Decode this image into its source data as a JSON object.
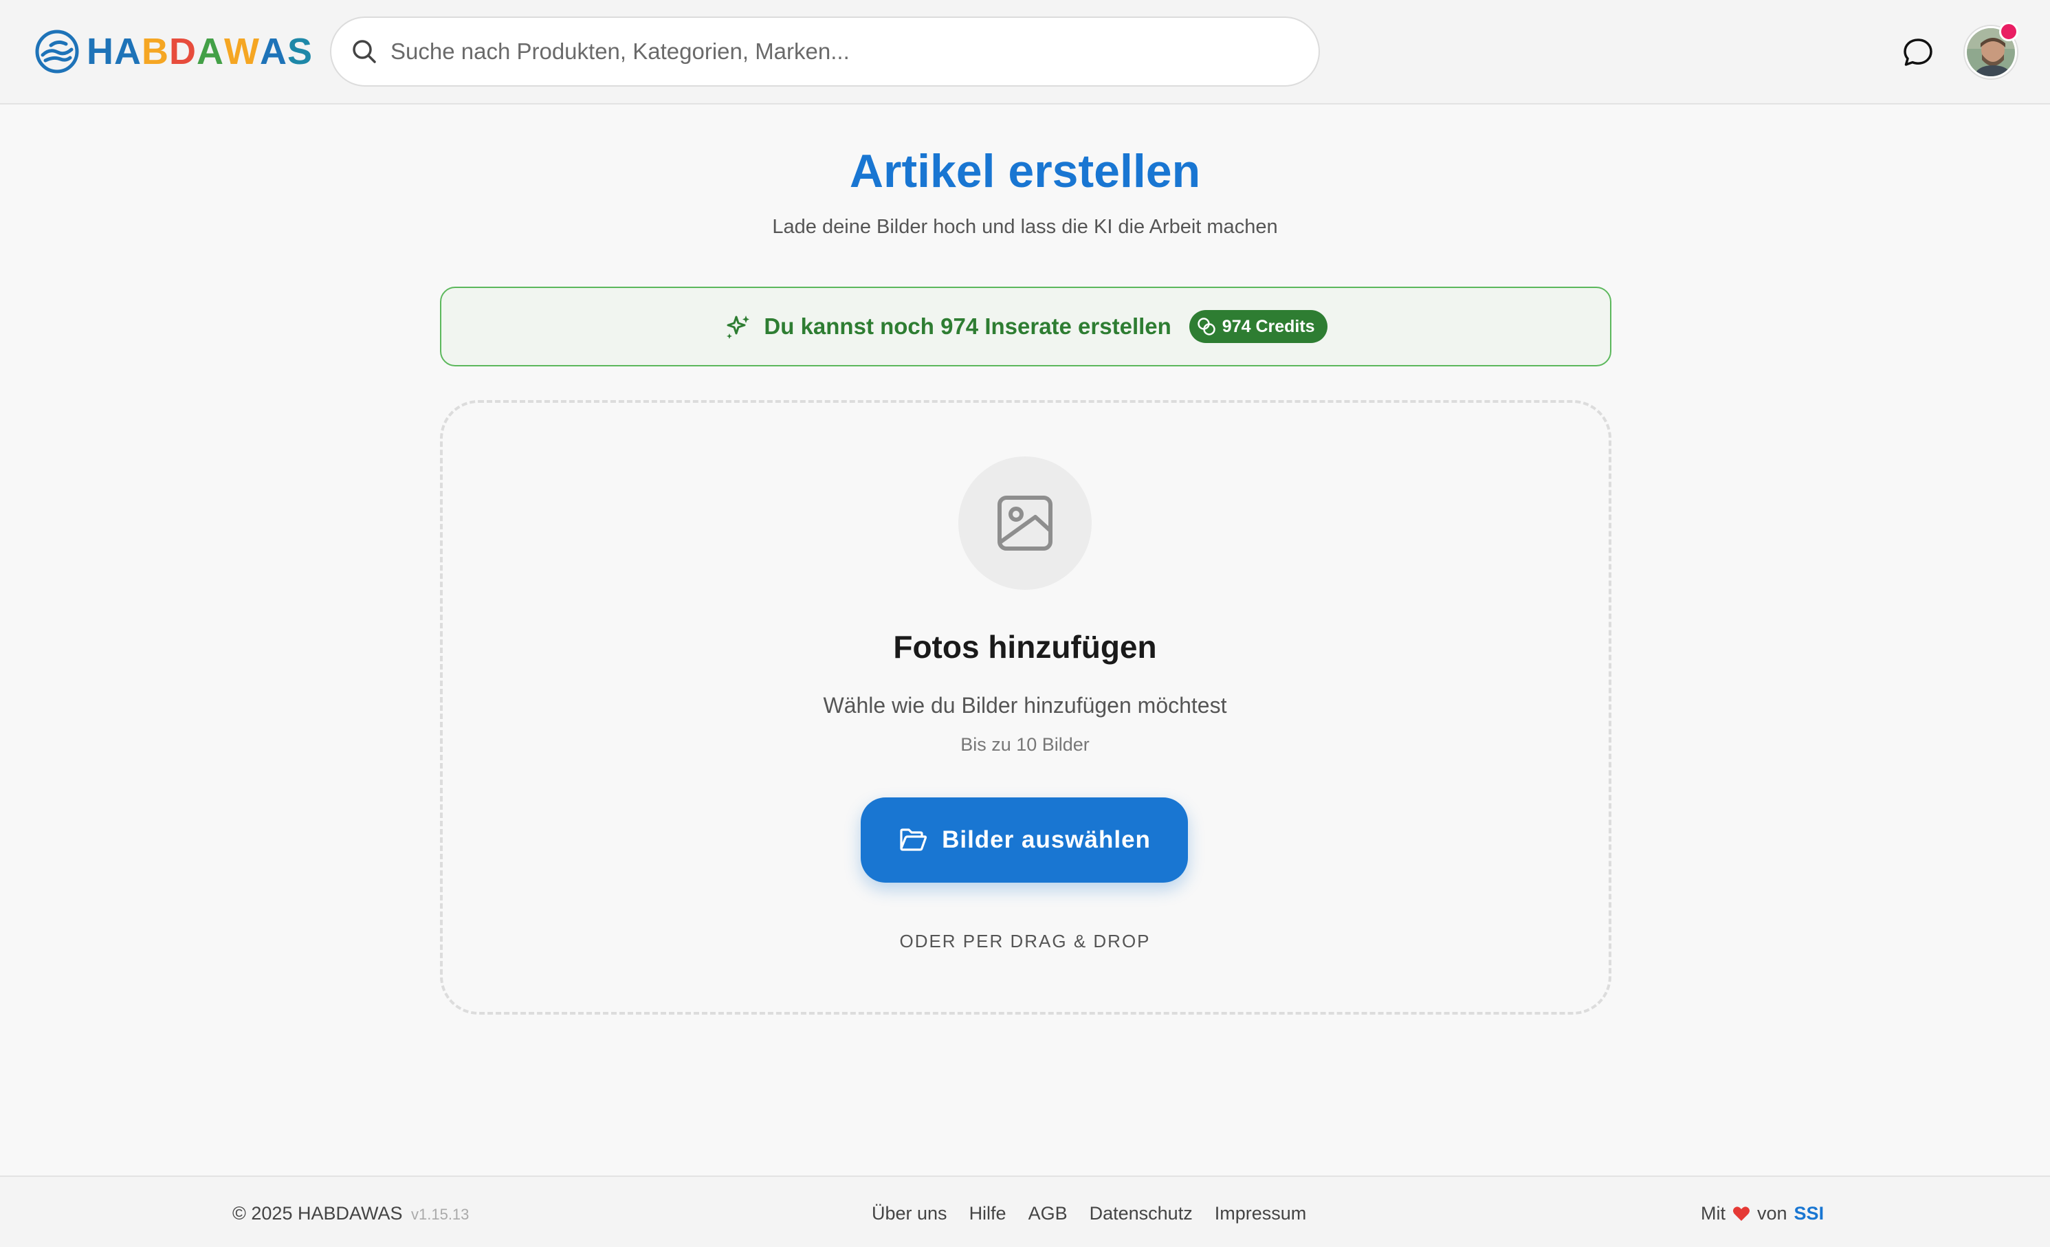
{
  "header": {
    "logo_letters": [
      {
        "char": "H",
        "color": "#1e73b8"
      },
      {
        "char": "A",
        "color": "#1e73b8"
      },
      {
        "char": "B",
        "color": "#f5a623"
      },
      {
        "char": "D",
        "color": "#e74c3c"
      },
      {
        "char": "A",
        "color": "#43a047"
      },
      {
        "char": "W",
        "color": "#f5a623"
      },
      {
        "char": "A",
        "color": "#1e73b8"
      },
      {
        "char": "S",
        "color": "#1e88a8"
      }
    ],
    "search_placeholder": "Suche nach Produkten, Kategorien, Marken...",
    "search_icon": "search-icon",
    "chat_icon": "chat-bubble-icon"
  },
  "main": {
    "title": "Artikel erstellen",
    "subtitle": "Lade deine Bilder hoch und lass die KI die Arbeit machen",
    "credits": {
      "message": "Du kannst noch 974 Inserate erstellen",
      "badge": "974 Credits",
      "icon": "sparkles-icon"
    },
    "upload": {
      "icon": "image-icon",
      "title": "Fotos hinzufügen",
      "subtitle": "Wähle wie du Bilder hinzufügen möchtest",
      "limit": "Bis zu 10 Bilder",
      "button_label": "Bilder auswählen",
      "drag_text": "ODER PER DRAG & DROP"
    }
  },
  "footer": {
    "copyright": "© 2025 HABDAWAS",
    "version": "v1.15.13",
    "links": [
      "Über uns",
      "Hilfe",
      "AGB",
      "Datenschutz",
      "Impressum"
    ],
    "made_with_prefix": "Mit",
    "made_with_mid": "von",
    "made_with_brand": "SSI"
  },
  "colors": {
    "primary": "#1976d2",
    "success": "#2e7d32",
    "success_border": "#5cb85c",
    "notification": "#e91e63",
    "heart": "#e53935"
  }
}
